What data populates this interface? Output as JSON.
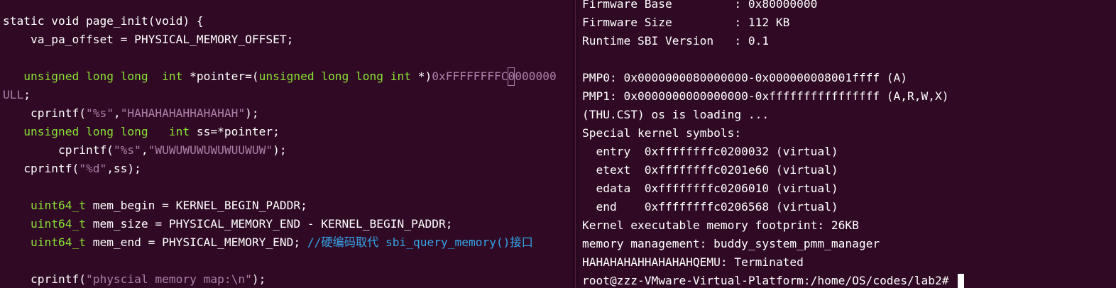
{
  "editor": {
    "lines": [
      {
        "p1": "static void page_init(void) {"
      },
      {
        "p1": "    va_pa_offset = PHYSICAL_MEMORY_OFFSET;"
      },
      {},
      {
        "p1": "   ",
        "kw1": "unsigned long long  int",
        "p2": " *pointer=(",
        "kw2": "unsigned long long int",
        "p3": " *)",
        "num1": "0xFFFFFFFFC",
        "cur": "0",
        "num2": "000000"
      },
      {
        "num1": "ULL",
        "p1": ";"
      },
      {
        "p1": "    cprintf(",
        "s1": "\"%s\"",
        "p2": ",",
        "s2": "\"HAHAHAHAHHAHAHAH\"",
        "p3": ");"
      },
      {
        "p1": "   ",
        "kw1": "unsigned long long   int",
        "p2": " ss=*pointer;"
      },
      {
        "p1": "        cprintf(",
        "s1": "\"%s\"",
        "p2": ",",
        "s2": "\"WUWUWUWUWUWUUWUW\"",
        "p3": ");"
      },
      {
        "p1": "   cprintf(",
        "s1": "\"%d\"",
        "p2": ",ss);"
      },
      {},
      {
        "p1": "    ",
        "kw1": "uint64_t",
        "p2": " mem_begin = KERNEL_BEGIN_PADDR;"
      },
      {
        "p1": "    ",
        "kw1": "uint64_t",
        "p2": " mem_size = PHYSICAL_MEMORY_END - KERNEL_BEGIN_PADDR;"
      },
      {
        "p1": "    ",
        "kw1": "uint64_t",
        "p2": " mem_end = PHYSICAL_MEMORY_END; ",
        "c1": "//硬编码取代 sbi_query_memory()接口"
      },
      {},
      {
        "p1": "    cprintf(",
        "s1": "\"physcial memory map:\\n\"",
        "p2": ");"
      }
    ]
  },
  "terminal": {
    "lines": [
      "Firmware Base         : 0x80000000",
      "Firmware Size         : 112 KB",
      "Runtime SBI Version   : 0.1",
      "",
      "PMP0: 0x0000000080000000-0x000000008001ffff (A)",
      "PMP1: 0x0000000000000000-0xffffffffffffffff (A,R,W,X)",
      "(THU.CST) os is loading ...",
      "Special kernel symbols:",
      "  entry  0xffffffffc0200032 (virtual)",
      "  etext  0xffffffffc0201e60 (virtual)",
      "  edata  0xffffffffc0206010 (virtual)",
      "  end    0xffffffffc0206568 (virtual)",
      "Kernel executable memory footprint: 26KB",
      "memory management: buddy_system_pmm_manager",
      "HAHAHAHAHHAHAHAHQEMU: Terminated"
    ],
    "prompt": "root@zzz-VMware-Virtual-Platform:/home/OS/codes/lab2# "
  },
  "colors": {
    "background": "#300a24",
    "keyword": "#8ae234",
    "string": "#ad7fa8",
    "comment": "#34a4e8",
    "text": "#ffffff"
  }
}
